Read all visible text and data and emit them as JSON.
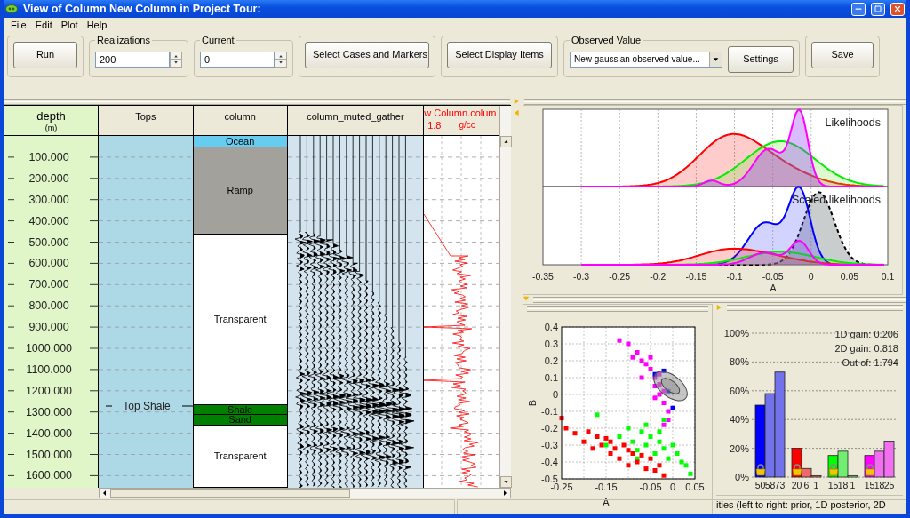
{
  "window": {
    "title": "View of Column New Column in Project Tour:"
  },
  "menu": [
    "File",
    "Edit",
    "Plot",
    "Help"
  ],
  "toolbar": {
    "run": "Run",
    "realizations": {
      "label": "Realizations",
      "value": "200"
    },
    "current": {
      "label": "Current",
      "value": "0"
    },
    "select_cases": "Select Cases and Markers",
    "select_display": "Select Display Items",
    "observed_value": {
      "label": "Observed Value",
      "value": "New gaussian observed value...",
      "settings": "Settings"
    },
    "save": "Save"
  },
  "depth_track": {
    "title": "depth",
    "unit": "(m)",
    "labels": [
      "100.000",
      "200.000",
      "300.000",
      "400.000",
      "500.000",
      "600.000",
      "700.000",
      "800.000",
      "900.000",
      "1000.000",
      "1100.000",
      "1200.000",
      "1300.000",
      "1400.000",
      "1500.000",
      "1600.000"
    ]
  },
  "tops_track": {
    "title": "Tops",
    "tops": [
      {
        "name": "Top Shale"
      }
    ]
  },
  "column_track": {
    "title": "column",
    "layers": [
      {
        "name": "Ocean",
        "color": "#66ccf0"
      },
      {
        "name": "Ramp",
        "color": "#a3a19b"
      },
      {
        "name": "Transparent",
        "color": "#ffffff"
      },
      {
        "name": "Shale",
        "color": "#008000"
      },
      {
        "name": "Sand",
        "color": "#008000"
      },
      {
        "name": "Transparent",
        "color": "#ffffff"
      }
    ]
  },
  "gather_track": {
    "title": "column_muted_gather"
  },
  "log_track": {
    "title": "w Column.colum",
    "min": "1.8",
    "unit": "g/cc"
  },
  "likelihood_plot": {
    "titles": [
      "Likelihoods",
      "Scaled likelihoods"
    ],
    "xticks": [
      "-0.35",
      "-0.3",
      "-0.25",
      "-0.2",
      "-0.15",
      "-0.1",
      "-0.05",
      "0",
      "0.05",
      "0.1"
    ],
    "xlabel": "A"
  },
  "scatter_plot": {
    "chart_data": {
      "type": "scatter",
      "xlabel": "A",
      "ylabel": "B",
      "grid": true,
      "xlim": [
        -0.25,
        0.05
      ],
      "ylim": [
        -0.5,
        0.4
      ],
      "xticks": [
        -0.25,
        -0.15,
        -0.05,
        0,
        0.05
      ],
      "yticks": [
        0.4,
        0.3,
        0.2,
        0.1,
        0,
        -0.1,
        -0.2,
        -0.3,
        -0.4,
        -0.5
      ],
      "series": [
        {
          "color": "#ff00ff",
          "x": [
            -0.12,
            -0.1,
            -0.09,
            -0.08,
            -0.07,
            -0.06,
            -0.05,
            -0.05,
            -0.04,
            -0.04,
            -0.03,
            -0.03,
            -0.02,
            -0.02,
            -0.01,
            -0.01,
            -0.02,
            -0.03,
            -0.07,
            -0.04
          ],
          "values": [
            0.32,
            0.3,
            0.22,
            0.25,
            0.2,
            0.18,
            0.15,
            0.22,
            0.1,
            0.05,
            0.12,
            0.0,
            -0.05,
            0.02,
            -0.1,
            -0.15,
            -0.18,
            0.06,
            0.1,
            -0.02
          ]
        },
        {
          "color": "#00ff00",
          "x": [
            -0.17,
            -0.15,
            -0.12,
            -0.1,
            -0.09,
            -0.08,
            -0.07,
            -0.06,
            -0.05,
            -0.04,
            -0.03,
            -0.02,
            -0.01,
            0.0,
            0.01,
            0.02,
            0.03,
            -0.06,
            -0.03,
            -0.08,
            0.04,
            -0.02
          ],
          "values": [
            -0.12,
            -0.3,
            -0.25,
            -0.2,
            -0.28,
            -0.33,
            -0.22,
            -0.3,
            -0.25,
            -0.35,
            -0.28,
            -0.32,
            -0.38,
            -0.3,
            -0.35,
            -0.4,
            -0.42,
            -0.18,
            -0.22,
            -0.38,
            -0.47,
            -0.15
          ]
        },
        {
          "color": "#ff0000",
          "x": [
            -0.25,
            -0.24,
            -0.22,
            -0.2,
            -0.19,
            -0.18,
            -0.16,
            -0.15,
            -0.14,
            -0.13,
            -0.12,
            -0.11,
            -0.1,
            -0.09,
            -0.08,
            -0.07,
            -0.06,
            -0.05,
            -0.04,
            -0.03,
            -0.02,
            -0.14,
            -0.1,
            -0.17
          ],
          "values": [
            -0.14,
            -0.2,
            -0.23,
            -0.28,
            -0.22,
            -0.32,
            -0.3,
            -0.26,
            -0.35,
            -0.32,
            -0.38,
            -0.3,
            -0.42,
            -0.35,
            -0.4,
            -0.36,
            -0.44,
            -0.38,
            -0.45,
            -0.42,
            -0.48,
            -0.28,
            -0.33,
            -0.25
          ]
        },
        {
          "color": "#0000ff",
          "x": [
            -0.04,
            -0.02,
            -0.01,
            0.0
          ],
          "values": [
            0.12,
            0.14,
            0.02,
            -0.08
          ]
        }
      ]
    }
  },
  "probability_plot": {
    "gains": [
      "1D gain: 0.206",
      "2D gain: 0.818",
      "Out of: 1.794"
    ],
    "caption": "ities (left to right: prior, 1D posterior, 2D",
    "chart_data": {
      "type": "bar",
      "grid": true,
      "ylim": [
        0,
        100
      ],
      "yticks": [
        {
          "value": 0,
          "label": "0%"
        },
        {
          "value": 20,
          "label": "20%"
        },
        {
          "value": 40,
          "label": "40%"
        },
        {
          "value": 60,
          "label": "60%"
        },
        {
          "value": 80,
          "label": "80%"
        },
        {
          "value": 100,
          "label": "100%"
        }
      ],
      "data_labels": true,
      "series": [
        {
          "colors": [
            "#0000ff",
            "#ff0000",
            "#00ff00",
            "#ff00ff"
          ],
          "values": [
            50,
            20,
            15,
            15
          ]
        },
        {
          "colors": [
            "#7272ea",
            "#f06868",
            "#70ee70",
            "#f070f0"
          ],
          "values": [
            58,
            6,
            18,
            18
          ]
        },
        {
          "colors": [
            "#7272ea",
            "#f06868",
            "#70ee70",
            "#f070f0"
          ],
          "values": [
            73,
            1,
            1,
            25
          ]
        }
      ]
    }
  }
}
